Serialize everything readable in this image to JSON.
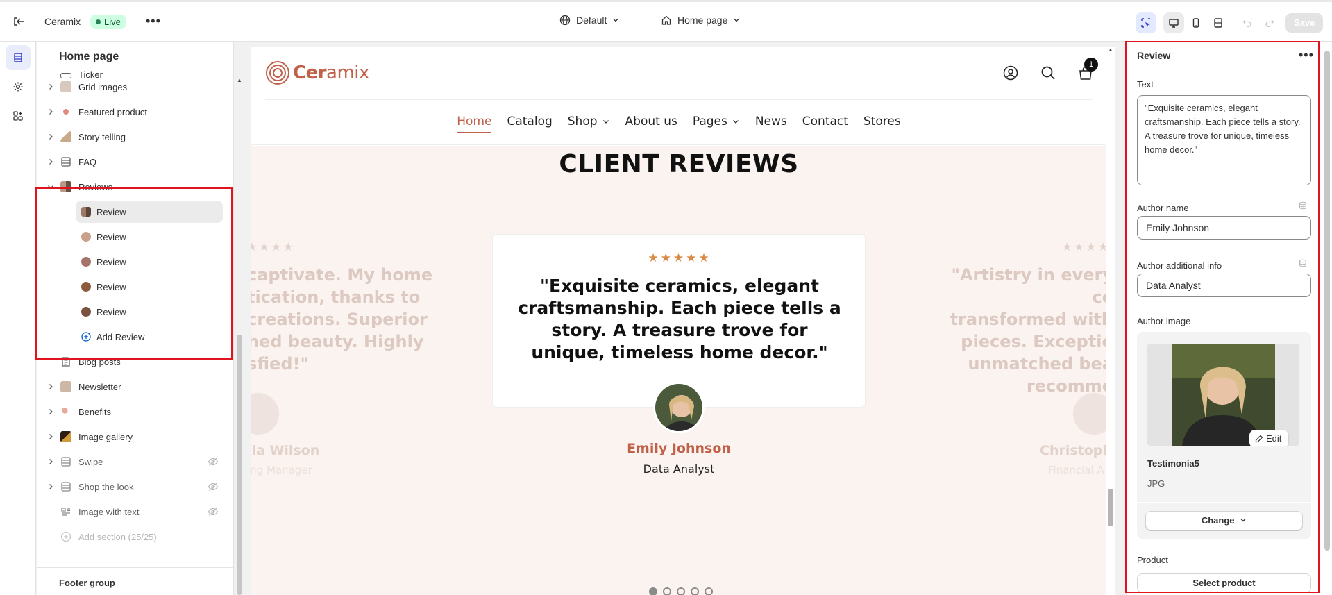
{
  "topbar": {
    "store_name": "Ceramix",
    "status_badge": "Live",
    "theme_selector": "Default",
    "page_selector": "Home page",
    "save_label": "Save"
  },
  "sidebar": {
    "title": "Home page",
    "partial_item": "Ticker",
    "items": [
      {
        "label": "Grid images",
        "icon": "image-thumb-icon",
        "expandable": true
      },
      {
        "label": "Featured product",
        "icon": "product-thumb-icon",
        "expandable": true
      },
      {
        "label": "Story telling",
        "icon": "story-thumb-icon",
        "expandable": true
      },
      {
        "label": "FAQ",
        "icon": "layout-icon",
        "expandable": true
      },
      {
        "label": "Reviews",
        "icon": "reviews-thumb-icon",
        "expandable": true,
        "expanded": true
      }
    ],
    "review_children": [
      "Review",
      "Review",
      "Review",
      "Review",
      "Review"
    ],
    "add_review": "Add Review",
    "items_after": [
      {
        "label": "Blog posts",
        "icon": "blog-icon",
        "expandable": false,
        "hidden": false
      },
      {
        "label": "Newsletter",
        "icon": "newsletter-thumb-icon",
        "expandable": true,
        "hidden": false
      },
      {
        "label": "Benefits",
        "icon": "benefits-thumb-icon",
        "expandable": true,
        "hidden": false
      },
      {
        "label": "Image gallery",
        "icon": "gallery-thumb-icon",
        "expandable": true,
        "hidden": false
      },
      {
        "label": "Swipe",
        "icon": "layout-icon",
        "expandable": true,
        "hidden": true
      },
      {
        "label": "Shop the look",
        "icon": "layout-icon",
        "expandable": true,
        "hidden": true
      },
      {
        "label": "Image with text",
        "icon": "image-text-icon",
        "expandable": false,
        "hidden": true
      }
    ],
    "add_section": "Add section (25/25)",
    "footer_group": "Footer group"
  },
  "preview": {
    "logo": "Ceramix",
    "cart_count": "1",
    "nav": [
      "Home",
      "Catalog",
      "Shop",
      "About us",
      "Pages",
      "News",
      "Contact",
      "Stores"
    ],
    "nav_dropdowns": [
      "Shop",
      "Pages"
    ],
    "heading": "CLIENT REVIEWS",
    "stars": "★★★★★",
    "quote": "\"Exquisite ceramics, elegant craftsmanship. Each piece tells a story. A treasure trove for unique, timeless home decor.\"",
    "author_name": "Emily Johnson",
    "author_info": "Data Analyst",
    "left_fragment": [
      "captivate. My home",
      "tication, thanks to",
      "creations. Superior",
      "hed beauty. Highly",
      "sfied!\""
    ],
    "left_name": "lla Wilson",
    "left_info": "ing Manager",
    "right_fragment": [
      "\"Artistry in every ce",
      "transformed with",
      "pieces. Exceptio",
      "unmatched bea",
      "recomme"
    ],
    "right_name": "Christophe",
    "right_info": "Financial A",
    "dots": 5,
    "active_dot": 0
  },
  "settings": {
    "title": "Review",
    "text_label": "Text",
    "text_value": "\"Exquisite ceramics, elegant craftsmanship. Each piece tells a story. A treasure trove for unique, timeless home decor.\"",
    "author_name_label": "Author name",
    "author_name_value": "Emily Johnson",
    "author_info_label": "Author additional info",
    "author_info_value": "Data Analyst",
    "author_image_label": "Author image",
    "image_edit": "Edit",
    "image_name": "Testimonia5",
    "image_type": "JPG",
    "change_label": "Change",
    "product_label": "Product",
    "select_product": "Select product"
  },
  "colors": {
    "brand": "#c0624a",
    "live_badge": "#cdfee1",
    "highlight": "#e0141e",
    "stars": "#d98a45",
    "section_bg": "#fbf3ef"
  }
}
